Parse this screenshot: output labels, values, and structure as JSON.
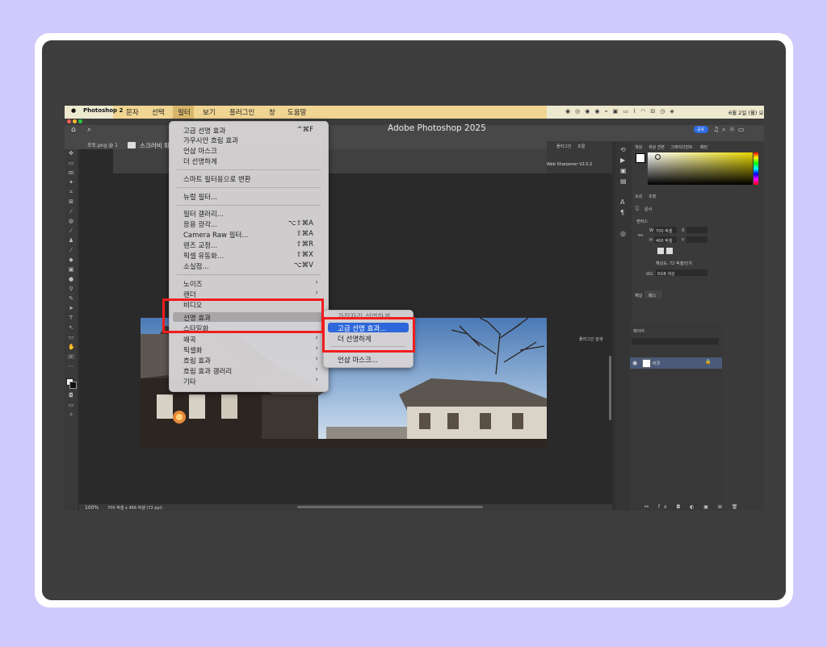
{
  "mac_menubar": {
    "app_name": "Photoshop 2",
    "menus": [
      "문자",
      "선택",
      "필터",
      "보기",
      "플러그인",
      "창",
      "도움말"
    ],
    "status_date": "6월 2일 (월) 오"
  },
  "app": {
    "title": "Adobe Photoshop 2025",
    "share_label": "공유",
    "doc_tab": "포토.png @ 1",
    "options_checkbox_label": "스크러비 확"
  },
  "filter_menu": {
    "items": [
      {
        "label": "고급 선명 효과",
        "shortcut": "^⌘F"
      },
      {
        "label": "가우시안 흐림 효과",
        "shortcut": ""
      },
      {
        "label": "언샵 마스크",
        "shortcut": ""
      },
      {
        "label": "더 선명하게",
        "shortcut": ""
      },
      {
        "label": "스마트 필터용으로 변환",
        "shortcut": ""
      },
      {
        "label": "뉴럴 필터...",
        "shortcut": ""
      },
      {
        "label": "필터 갤러리...",
        "shortcut": ""
      },
      {
        "label": "응용 광각...",
        "shortcut": "⌥⇧⌘A"
      },
      {
        "label": "Camera Raw 필터...",
        "shortcut": "⇧⌘A"
      },
      {
        "label": "렌즈 교정...",
        "shortcut": "⇧⌘R"
      },
      {
        "label": "픽셀 유동화...",
        "shortcut": "⇧⌘X"
      },
      {
        "label": "소실점...",
        "shortcut": "⌥⌘V"
      },
      {
        "label": "노이즈",
        "shortcut": ""
      },
      {
        "label": "렌더",
        "shortcut": ""
      },
      {
        "label": "비디오",
        "shortcut": ""
      },
      {
        "label": "선명 효과",
        "shortcut": ""
      },
      {
        "label": "스타일화",
        "shortcut": ""
      },
      {
        "label": "왜곡",
        "shortcut": ""
      },
      {
        "label": "픽셀화",
        "shortcut": ""
      },
      {
        "label": "흐림 효과",
        "shortcut": ""
      },
      {
        "label": "흐림 효과 갤러리",
        "shortcut": ""
      },
      {
        "label": "기타",
        "shortcut": ""
      }
    ]
  },
  "sharpen_submenu": {
    "items": [
      "고급 선명 효과...",
      "더 선명하게",
      "언샵 마스크..."
    ],
    "hidden_top": "가장자리 선명하게"
  },
  "right_panel": {
    "tabs_top": [
      "색상",
      "색상 견본",
      "그레이디언트",
      "패턴"
    ],
    "props_tabs": [
      "속성",
      "조정"
    ],
    "doc_label": "문서",
    "canvas_section": "캔버스",
    "w_label": "W",
    "w_value": "700 픽셀",
    "h_label": "H",
    "h_value": "466 픽셀",
    "x_label": "X",
    "y_label": "Y",
    "resolution": "해상도: 72 픽셀/인치",
    "mode_label": "모드",
    "mode_value": "RGB 색상",
    "channel_tabs": [
      "채널",
      "패스"
    ],
    "layers_tab": "레이어",
    "layer_name": "배경",
    "plugin_tabs": [
      "플러그인",
      "조절"
    ],
    "plugin_name": "Web Sharpener V2.0.2",
    "plugin_search": "플러그인 검색"
  },
  "status": {
    "zoom": "100%",
    "doc_info": "700 픽셀 x 466 픽셀 (72 ppi)"
  },
  "colors": {
    "highlight": "#2e67d9",
    "annotation_red": "#f01d1d",
    "menubar_highlight": "#f1d592"
  }
}
